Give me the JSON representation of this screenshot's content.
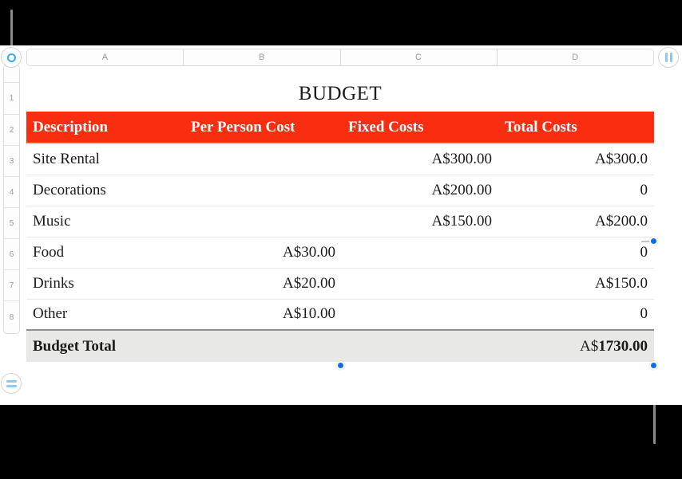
{
  "app": {
    "background_color": "#000000",
    "canvas_color": "#ffffff",
    "accent_color": "#0b6ef3",
    "table_header_color": "#f92d10",
    "total_row_color": "#e8e8e6",
    "icon_blue": "#8ecbfa"
  },
  "controls": {
    "corner_select_label": "",
    "pause_button_label": "",
    "row_options_label": ""
  },
  "column_headers": [
    "A",
    "B",
    "C",
    "D"
  ],
  "row_headers": [
    "",
    "1",
    "2",
    "3",
    "4",
    "5",
    "6",
    "7",
    "8"
  ],
  "sheet": {
    "title": "BUDGET"
  },
  "table": {
    "headers": [
      "Description",
      "Per Person Cost",
      "Fixed Costs",
      "Total Costs"
    ],
    "rows": [
      {
        "description": "Site Rental",
        "per_person": "",
        "fixed": "A$300.00",
        "total": "A$300.0"
      },
      {
        "description": "Decorations",
        "per_person": "",
        "fixed": "A$200.00",
        "total": "0"
      },
      {
        "description": "Music",
        "per_person": "",
        "fixed": "A$150.00",
        "total": "A$200.0"
      },
      {
        "description": "Food",
        "per_person": "A$30.00",
        "fixed": "",
        "total": "0"
      },
      {
        "description": "Drinks",
        "per_person": "A$20.00",
        "fixed": "",
        "total": "A$150.0"
      },
      {
        "description": "Other",
        "per_person": "A$10.00",
        "fixed": "",
        "total": "0"
      }
    ],
    "total_row": {
      "label": "Budget Total",
      "per_person": "",
      "fixed": "",
      "currency_prefix": "A$",
      "amount": "1730.00"
    }
  }
}
